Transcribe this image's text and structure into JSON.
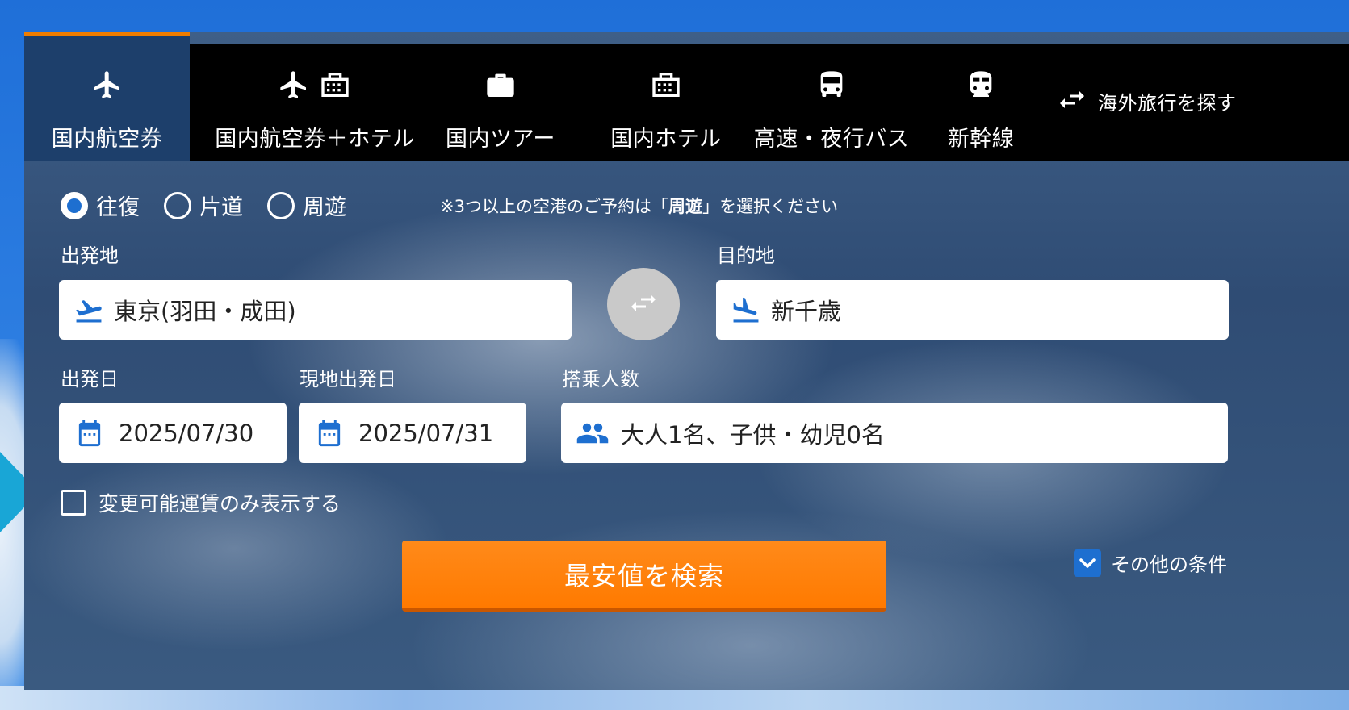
{
  "tabs": [
    {
      "label": "国内航空券",
      "icon": "airplane-icon",
      "active": true
    },
    {
      "label": "国内航空券＋ホテル",
      "icon": "airplane-hotel-icon"
    },
    {
      "label": "国内ツアー",
      "icon": "suitcase-icon"
    },
    {
      "label": "国内ホテル",
      "icon": "hotel-icon"
    },
    {
      "label": "高速・夜行バス",
      "icon": "bus-icon"
    },
    {
      "label": "新幹線",
      "icon": "train-icon"
    },
    {
      "label": "海外旅行を探す",
      "icon": "swap-icon"
    }
  ],
  "trip_type": {
    "options": [
      "往復",
      "片道",
      "周遊"
    ],
    "selected": "往復",
    "note_prefix": "※3つ以上の空港のご予約は「",
    "note_bold": "周遊",
    "note_suffix": "」を選択ください"
  },
  "departure": {
    "label": "出発地",
    "value": "東京(羽田・成田)"
  },
  "destination": {
    "label": "目的地",
    "value": "新千歳"
  },
  "depart_date": {
    "label": "出発日",
    "value": "2025/07/30"
  },
  "return_date": {
    "label": "現地出発日",
    "value": "2025/07/31"
  },
  "passengers": {
    "label": "搭乗人数",
    "value": "大人1名、子供・幼児0名"
  },
  "changeable_only": {
    "label": "変更可能運賃のみ表示する",
    "checked": false
  },
  "search_button": {
    "label": "最安値を検索"
  },
  "other_conditions": {
    "label": "その他の条件"
  },
  "colors": {
    "accent": "#f07d00",
    "primary_blue": "#1e6fd0",
    "search_orange": "#ff7a00"
  }
}
